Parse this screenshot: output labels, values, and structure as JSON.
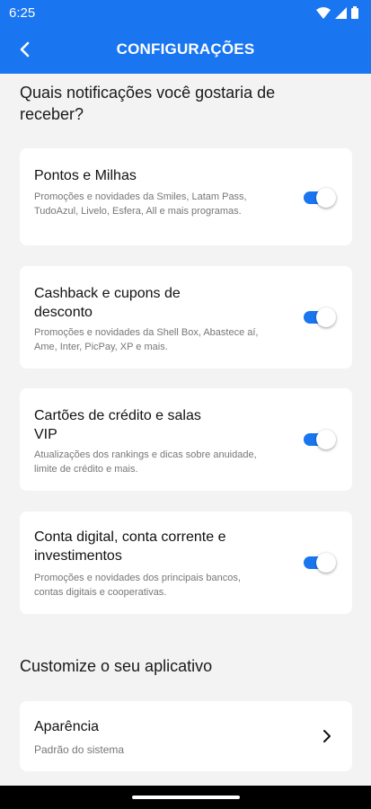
{
  "status_bar": {
    "time": "6:25"
  },
  "app_bar": {
    "title": "CONFIGURAÇÕES"
  },
  "notifications": {
    "heading": "Quais notificações você gostaria de receber?",
    "items": [
      {
        "title": "Pontos e Milhas",
        "description": "Promoções e novidades da Smiles, Latam Pass, TudoAzul, Livelo, Esfera, All e mais programas.",
        "enabled": true
      },
      {
        "title": "Cashback e cupons de desconto",
        "description": "Promoções e novidades da Shell Box, Abastece aí, Ame, Inter, PicPay, XP e mais.",
        "enabled": true
      },
      {
        "title": "Cartões de crédito e salas VIP",
        "description": "Atualizações dos rankings e dicas sobre anuidade, limite de crédito e mais.",
        "enabled": true
      },
      {
        "title": "Conta digital, conta corrente e investimentos",
        "description": "Promoções e novidades dos principais bancos, contas digitais e cooperativas.",
        "enabled": true
      }
    ]
  },
  "customize": {
    "heading": "Customize o seu aplicativo",
    "appearance": {
      "title": "Aparência",
      "value": "Padrão do sistema"
    }
  },
  "colors": {
    "primary": "#1976f0",
    "background": "#f3f3f3",
    "card": "#ffffff"
  }
}
